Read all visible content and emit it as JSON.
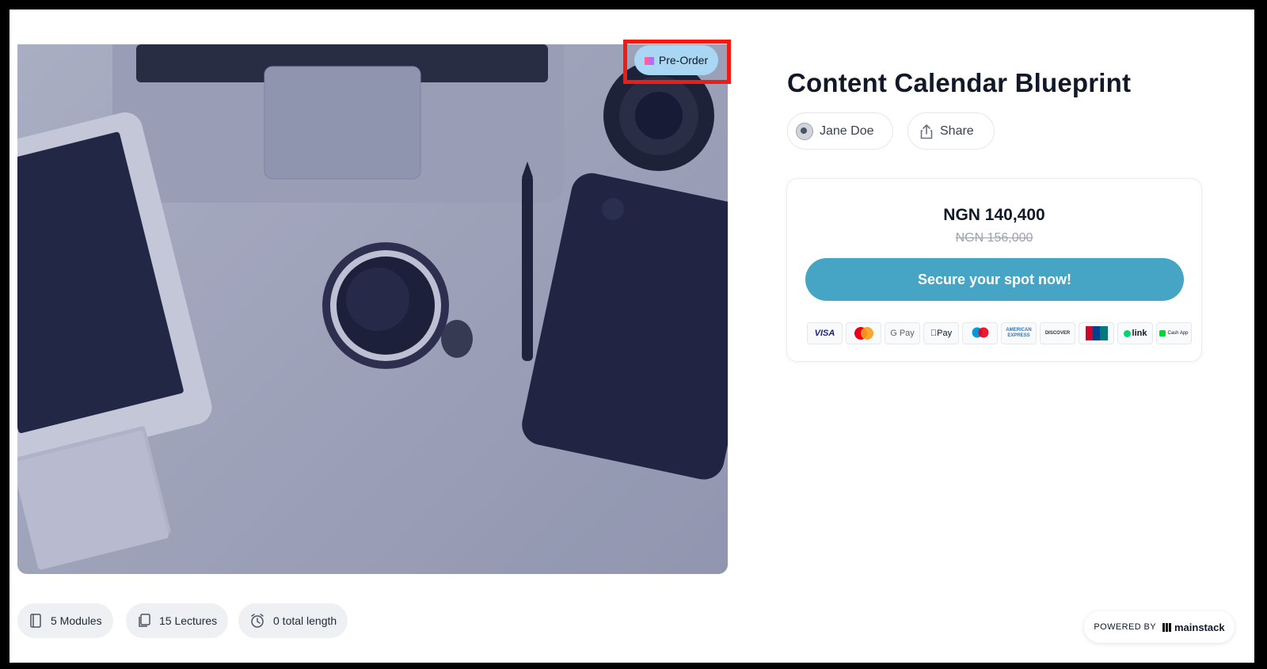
{
  "product": {
    "title": "Content Calendar Blueprint",
    "badge": "Pre-Order",
    "author": "Jane Doe",
    "share_label": "Share"
  },
  "pricing": {
    "price": "NGN 140,400",
    "original_price": "NGN 156,000",
    "cta_label": "Secure your spot now!"
  },
  "payment_methods": [
    {
      "name": "VISA",
      "icon": "visa-icon",
      "color": "#1a1f71"
    },
    {
      "name": "mastercard",
      "icon": "mastercard-icon",
      "color": "#eb001b"
    },
    {
      "name": "G Pay",
      "icon": "google-pay-icon",
      "color": "#5f6368"
    },
    {
      "name": "Pay",
      "icon": "apple-pay-icon",
      "color": "#000000"
    },
    {
      "name": "maestro",
      "icon": "maestro-icon",
      "color": "#0099df"
    },
    {
      "name": "AMERICAN EXPRESS",
      "icon": "amex-icon",
      "color": "#2e77bb"
    },
    {
      "name": "DISCOVER",
      "icon": "discover-icon",
      "color": "#f48120"
    },
    {
      "name": "UnionPay",
      "icon": "unionpay-icon",
      "color": "#d10429"
    },
    {
      "name": "link",
      "icon": "link-icon",
      "color": "#00d66f"
    },
    {
      "name": "Cash App",
      "icon": "cash-app-icon",
      "color": "#00d632"
    }
  ],
  "stats": {
    "modules": "5 Modules",
    "lectures": "15 Lectures",
    "length": "0 total length"
  },
  "footer": {
    "powered_by": "POWERED BY",
    "brand": "mainstack"
  },
  "colors": {
    "cta": "#46a4c5",
    "badge": "#a9d6f2",
    "highlight": "#ee1c12"
  }
}
